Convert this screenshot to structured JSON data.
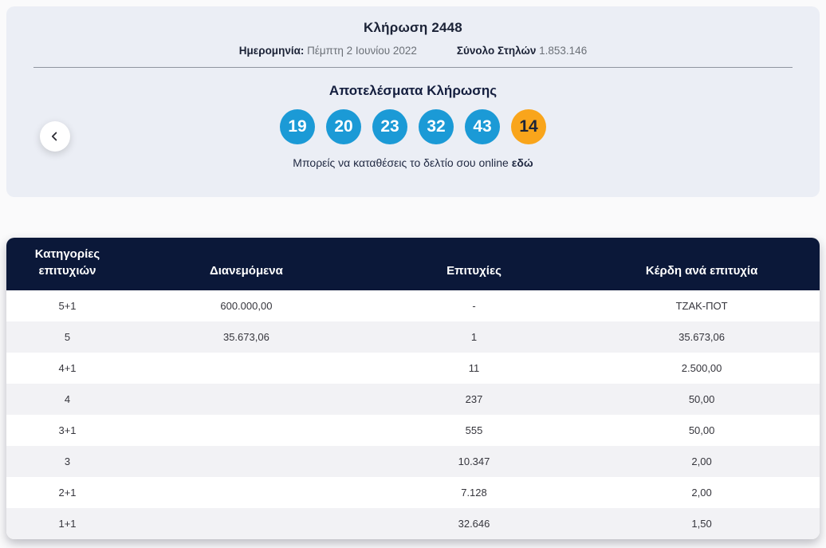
{
  "draw": {
    "title": "Κλήρωση 2448",
    "date_label": "Ημερομηνία:",
    "date_value": "Πέμπτη 2 Ιουνίου 2022",
    "columns_label": "Σύνολο Στηλών",
    "columns_value": "1.853.146",
    "results_title": "Αποτελέσματα Κλήρωσης",
    "numbers": [
      "19",
      "20",
      "23",
      "32",
      "43"
    ],
    "joker": "14",
    "note_text": "Μπορείς να καταθέσεις το δελτίο σου online",
    "note_link": "εδώ"
  },
  "colors": {
    "ball_blue": "#1b9ad6",
    "ball_orange": "#f9a51b",
    "header_navy": "#0b1839",
    "card_background": "#ebeef5",
    "row_alt_gray": "#f2f2f5"
  },
  "table": {
    "headers": [
      "Κατηγορίες επιτυχιών",
      "Διανεμόμενα",
      "Επιτυχίες",
      "Κέρδη ανά επιτυχία"
    ],
    "rows": [
      [
        "5+1",
        "600.000,00",
        "-",
        "ΤΖΑΚ-ΠΟΤ"
      ],
      [
        "5",
        "35.673,06",
        "1",
        "35.673,06"
      ],
      [
        "4+1",
        "",
        "11",
        "2.500,00"
      ],
      [
        "4",
        "",
        "237",
        "50,00"
      ],
      [
        "3+1",
        "",
        "555",
        "50,00"
      ],
      [
        "3",
        "",
        "10.347",
        "2,00"
      ],
      [
        "2+1",
        "",
        "7.128",
        "2,00"
      ],
      [
        "1+1",
        "",
        "32.646",
        "1,50"
      ]
    ]
  }
}
